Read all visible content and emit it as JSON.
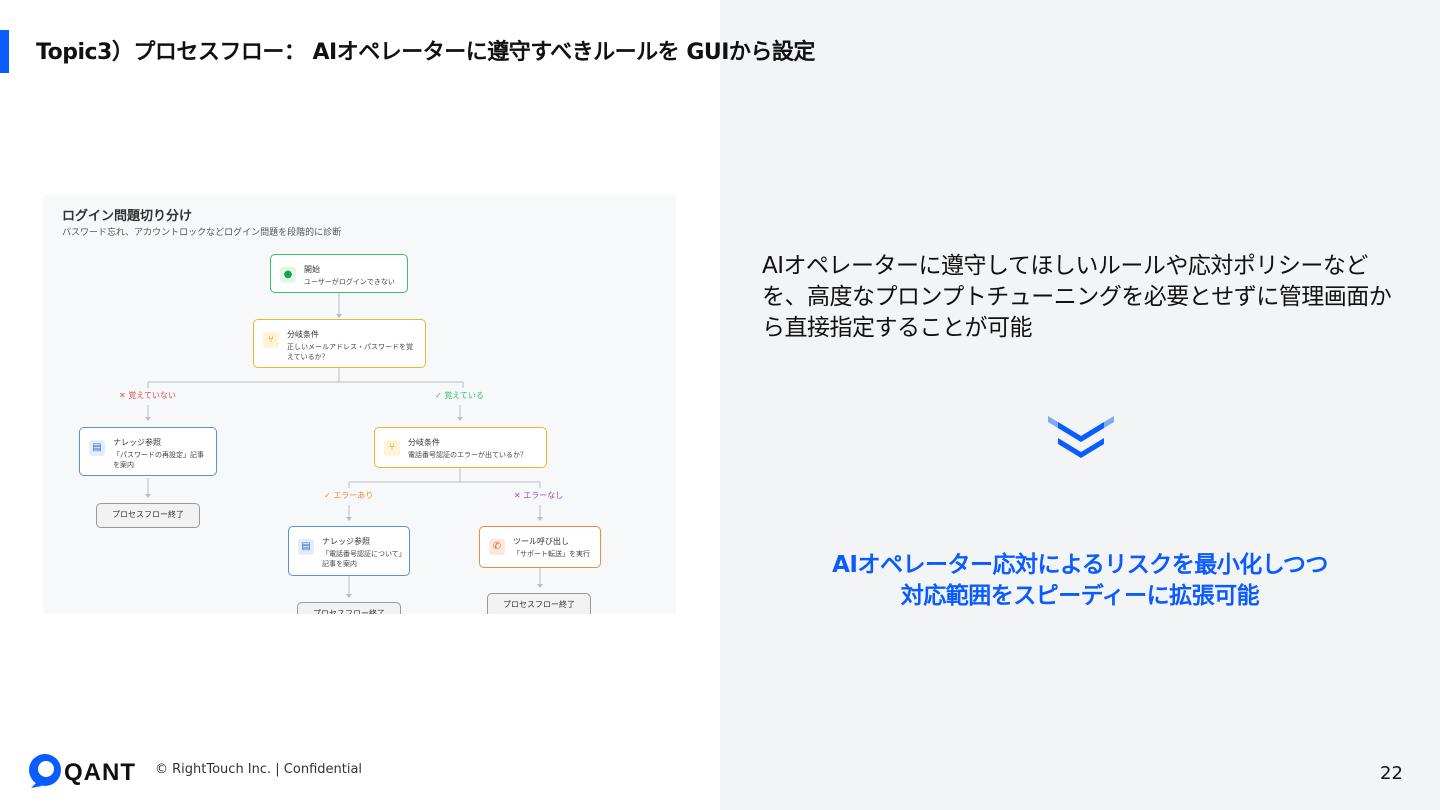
{
  "slide": {
    "title": "Topic3）プロセスフロー： AIオペレーターに遵守すべきルールを  GUIから設定",
    "page_number": "22"
  },
  "flow": {
    "title": "ログイン問題切り分け",
    "subtitle": "パスワード忘れ、アカウントロックなどログイン問題を段階的に診断",
    "start": {
      "title": "開始",
      "desc": "ユーザーがログインできない"
    },
    "branch1": {
      "title": "分岐条件",
      "desc": "正しいメールアドレス・パスワードを覚えているか？"
    },
    "label_no": "✕ 覚えていない",
    "label_yes": "✓ 覚えている",
    "knowledge1": {
      "title": "ナレッジ参照",
      "desc": "「パスワードの再設定」記事を案内"
    },
    "end1": "プロセスフロー終了",
    "branch2": {
      "title": "分岐条件",
      "desc": "電話番号認証のエラーが出ているか？"
    },
    "label_error_yes": "✓ エラーあり",
    "label_error_no": "✕ エラーなし",
    "knowledge2": {
      "title": "ナレッジ参照",
      "desc": "「電話番号認証について」記事を案内"
    },
    "tool": {
      "title": "ツール呼び出し",
      "desc": "「サポート転送」を実行"
    },
    "end2": "プロセスフロー終了",
    "end3": "プロセスフロー終了",
    "colors": {
      "green": "#34c26b",
      "yellow": "#f0b429",
      "blue": "#5b8fd9",
      "orange": "#f08a3c",
      "red": "#e5484d",
      "violet": "#8e4ec6"
    }
  },
  "description": "AIオペレーターに遵守してほしいルールや応対ポリシーなどを、高度なプロンプトチューニングを必要とせずに管理画面から直接指定することが可能",
  "result": {
    "line1": "AIオペレーター応対によるリスクを最小化しつつ",
    "line2": "対応範囲をスピーディーに拡張可能",
    "color": "#0a5cff"
  },
  "footer": {
    "logo_text": "QANT",
    "copyright": "© RightTouch Inc.  |   Confidential"
  }
}
